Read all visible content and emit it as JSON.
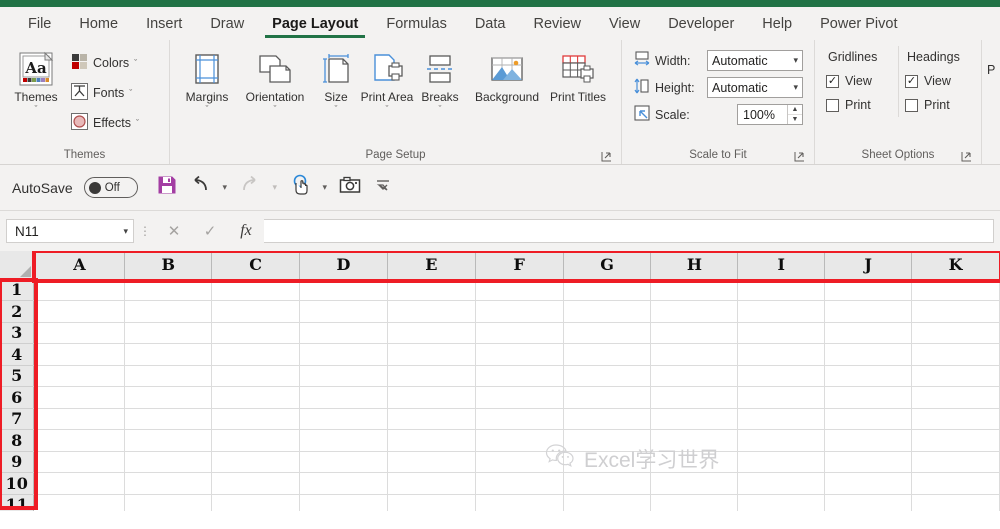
{
  "app": {
    "accent_green": "#217346",
    "highlight_red": "#ee1c25"
  },
  "tabs": [
    {
      "label": "File",
      "active": false
    },
    {
      "label": "Home",
      "active": false
    },
    {
      "label": "Insert",
      "active": false
    },
    {
      "label": "Draw",
      "active": false
    },
    {
      "label": "Page Layout",
      "active": true
    },
    {
      "label": "Formulas",
      "active": false
    },
    {
      "label": "Data",
      "active": false
    },
    {
      "label": "Review",
      "active": false
    },
    {
      "label": "View",
      "active": false
    },
    {
      "label": "Developer",
      "active": false
    },
    {
      "label": "Help",
      "active": false
    },
    {
      "label": "Power Pivot",
      "active": false
    }
  ],
  "ribbon": {
    "themes": {
      "group_label": "Themes",
      "big": {
        "label": "Themes",
        "icon": "themes-aa-icon",
        "chevron": "ˇ"
      },
      "items": [
        {
          "label": "Colors",
          "icon": "theme-colors-icon",
          "chevron": "ˇ"
        },
        {
          "label": "Fonts",
          "icon": "theme-fonts-icon",
          "chevron": "ˇ"
        },
        {
          "label": "Effects",
          "icon": "theme-effects-icon",
          "chevron": "ˇ"
        }
      ]
    },
    "page_setup": {
      "group_label": "Page Setup",
      "buttons": [
        {
          "label": "Margins",
          "icon": "margins-icon",
          "chevron": "ˇ"
        },
        {
          "label": "Orientation",
          "icon": "orientation-icon",
          "chevron": "ˇ"
        },
        {
          "label": "Size",
          "icon": "size-icon",
          "chevron": "ˇ"
        },
        {
          "label": "Print Area",
          "icon": "print-area-icon",
          "chevron": "ˇ"
        },
        {
          "label": "Breaks",
          "icon": "breaks-icon",
          "chevron": "ˇ"
        },
        {
          "label": "Background",
          "icon": "background-icon",
          "chevron": ""
        },
        {
          "label": "Print Titles",
          "icon": "print-titles-icon",
          "chevron": ""
        }
      ]
    },
    "scale_to_fit": {
      "group_label": "Scale to Fit",
      "width": {
        "label": "Width:",
        "value": "Automatic",
        "icon": "fit-width-icon"
      },
      "height": {
        "label": "Height:",
        "value": "Automatic",
        "icon": "fit-height-icon"
      },
      "scale": {
        "label": "Scale:",
        "value": "100%",
        "icon": "scale-icon"
      }
    },
    "sheet_options": {
      "group_label": "Sheet Options",
      "columns": [
        {
          "header": "Gridlines",
          "checks": [
            {
              "label": "View",
              "checked": true
            },
            {
              "label": "Print",
              "checked": false
            }
          ]
        },
        {
          "header": "Headings",
          "checks": [
            {
              "label": "View",
              "checked": true
            },
            {
              "label": "Print",
              "checked": false
            }
          ]
        }
      ]
    },
    "next_group_partial": "P"
  },
  "qat": {
    "autosave_label": "AutoSave",
    "autosave_state": "Off",
    "buttons": [
      {
        "name": "save-icon",
        "label": "Save"
      },
      {
        "name": "undo-icon",
        "label": "Undo"
      },
      {
        "name": "redo-icon",
        "label": "Redo"
      },
      {
        "name": "touch-mode-icon",
        "label": "Touch/Mouse Mode"
      },
      {
        "name": "camera-icon",
        "label": "Camera"
      },
      {
        "name": "customize-qat-icon",
        "label": "Customize Quick Access Toolbar"
      }
    ]
  },
  "formula_bar": {
    "name_box_value": "N11",
    "name_box_placeholder": "Name Box",
    "cancel_icon": "✕",
    "enter_icon": "✓",
    "function_icon": "fx",
    "input_value": "",
    "input_placeholder": ""
  },
  "grid": {
    "columns": [
      "A",
      "B",
      "C",
      "D",
      "E",
      "F",
      "G",
      "H",
      "I",
      "J",
      "K"
    ],
    "rows": [
      "1",
      "2",
      "3",
      "4",
      "5",
      "6",
      "7",
      "8",
      "9",
      "10",
      "11"
    ],
    "selected_cell": "N11"
  },
  "watermark": {
    "icon": "wechat-icon",
    "text": "Excel学习世界"
  }
}
